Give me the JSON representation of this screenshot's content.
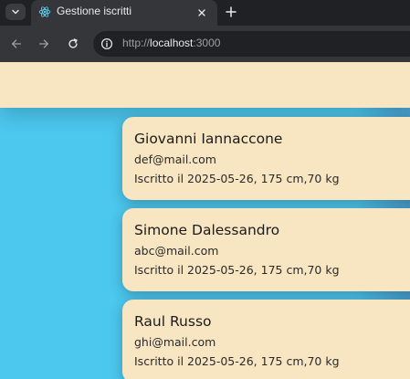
{
  "browser": {
    "tab": {
      "title": "Gestione iscritti",
      "favicon": "react-icon"
    },
    "address_bar": {
      "scheme": "http://",
      "host": "localhost",
      "port": ":3000"
    },
    "colors": {
      "tab_strip": "#202124",
      "toolbar": "#35363a",
      "favicon": "#61dafb"
    }
  },
  "page": {
    "colors": {
      "background": "#4cc7ee",
      "card": "#f8e6c3",
      "header": "#f8e6c3"
    },
    "members": [
      {
        "name": "Giovanni Iannaccone",
        "email": "def@mail.com",
        "details": "Iscritto il 2025-05-26, 175 cm,70 kg"
      },
      {
        "name": "Simone Dalessandro",
        "email": "abc@mail.com",
        "details": "Iscritto il 2025-05-26, 175 cm,70 kg"
      },
      {
        "name": "Raul Russo",
        "email": "ghi@mail.com",
        "details": "Iscritto il 2025-05-26, 175 cm,70 kg"
      }
    ]
  }
}
